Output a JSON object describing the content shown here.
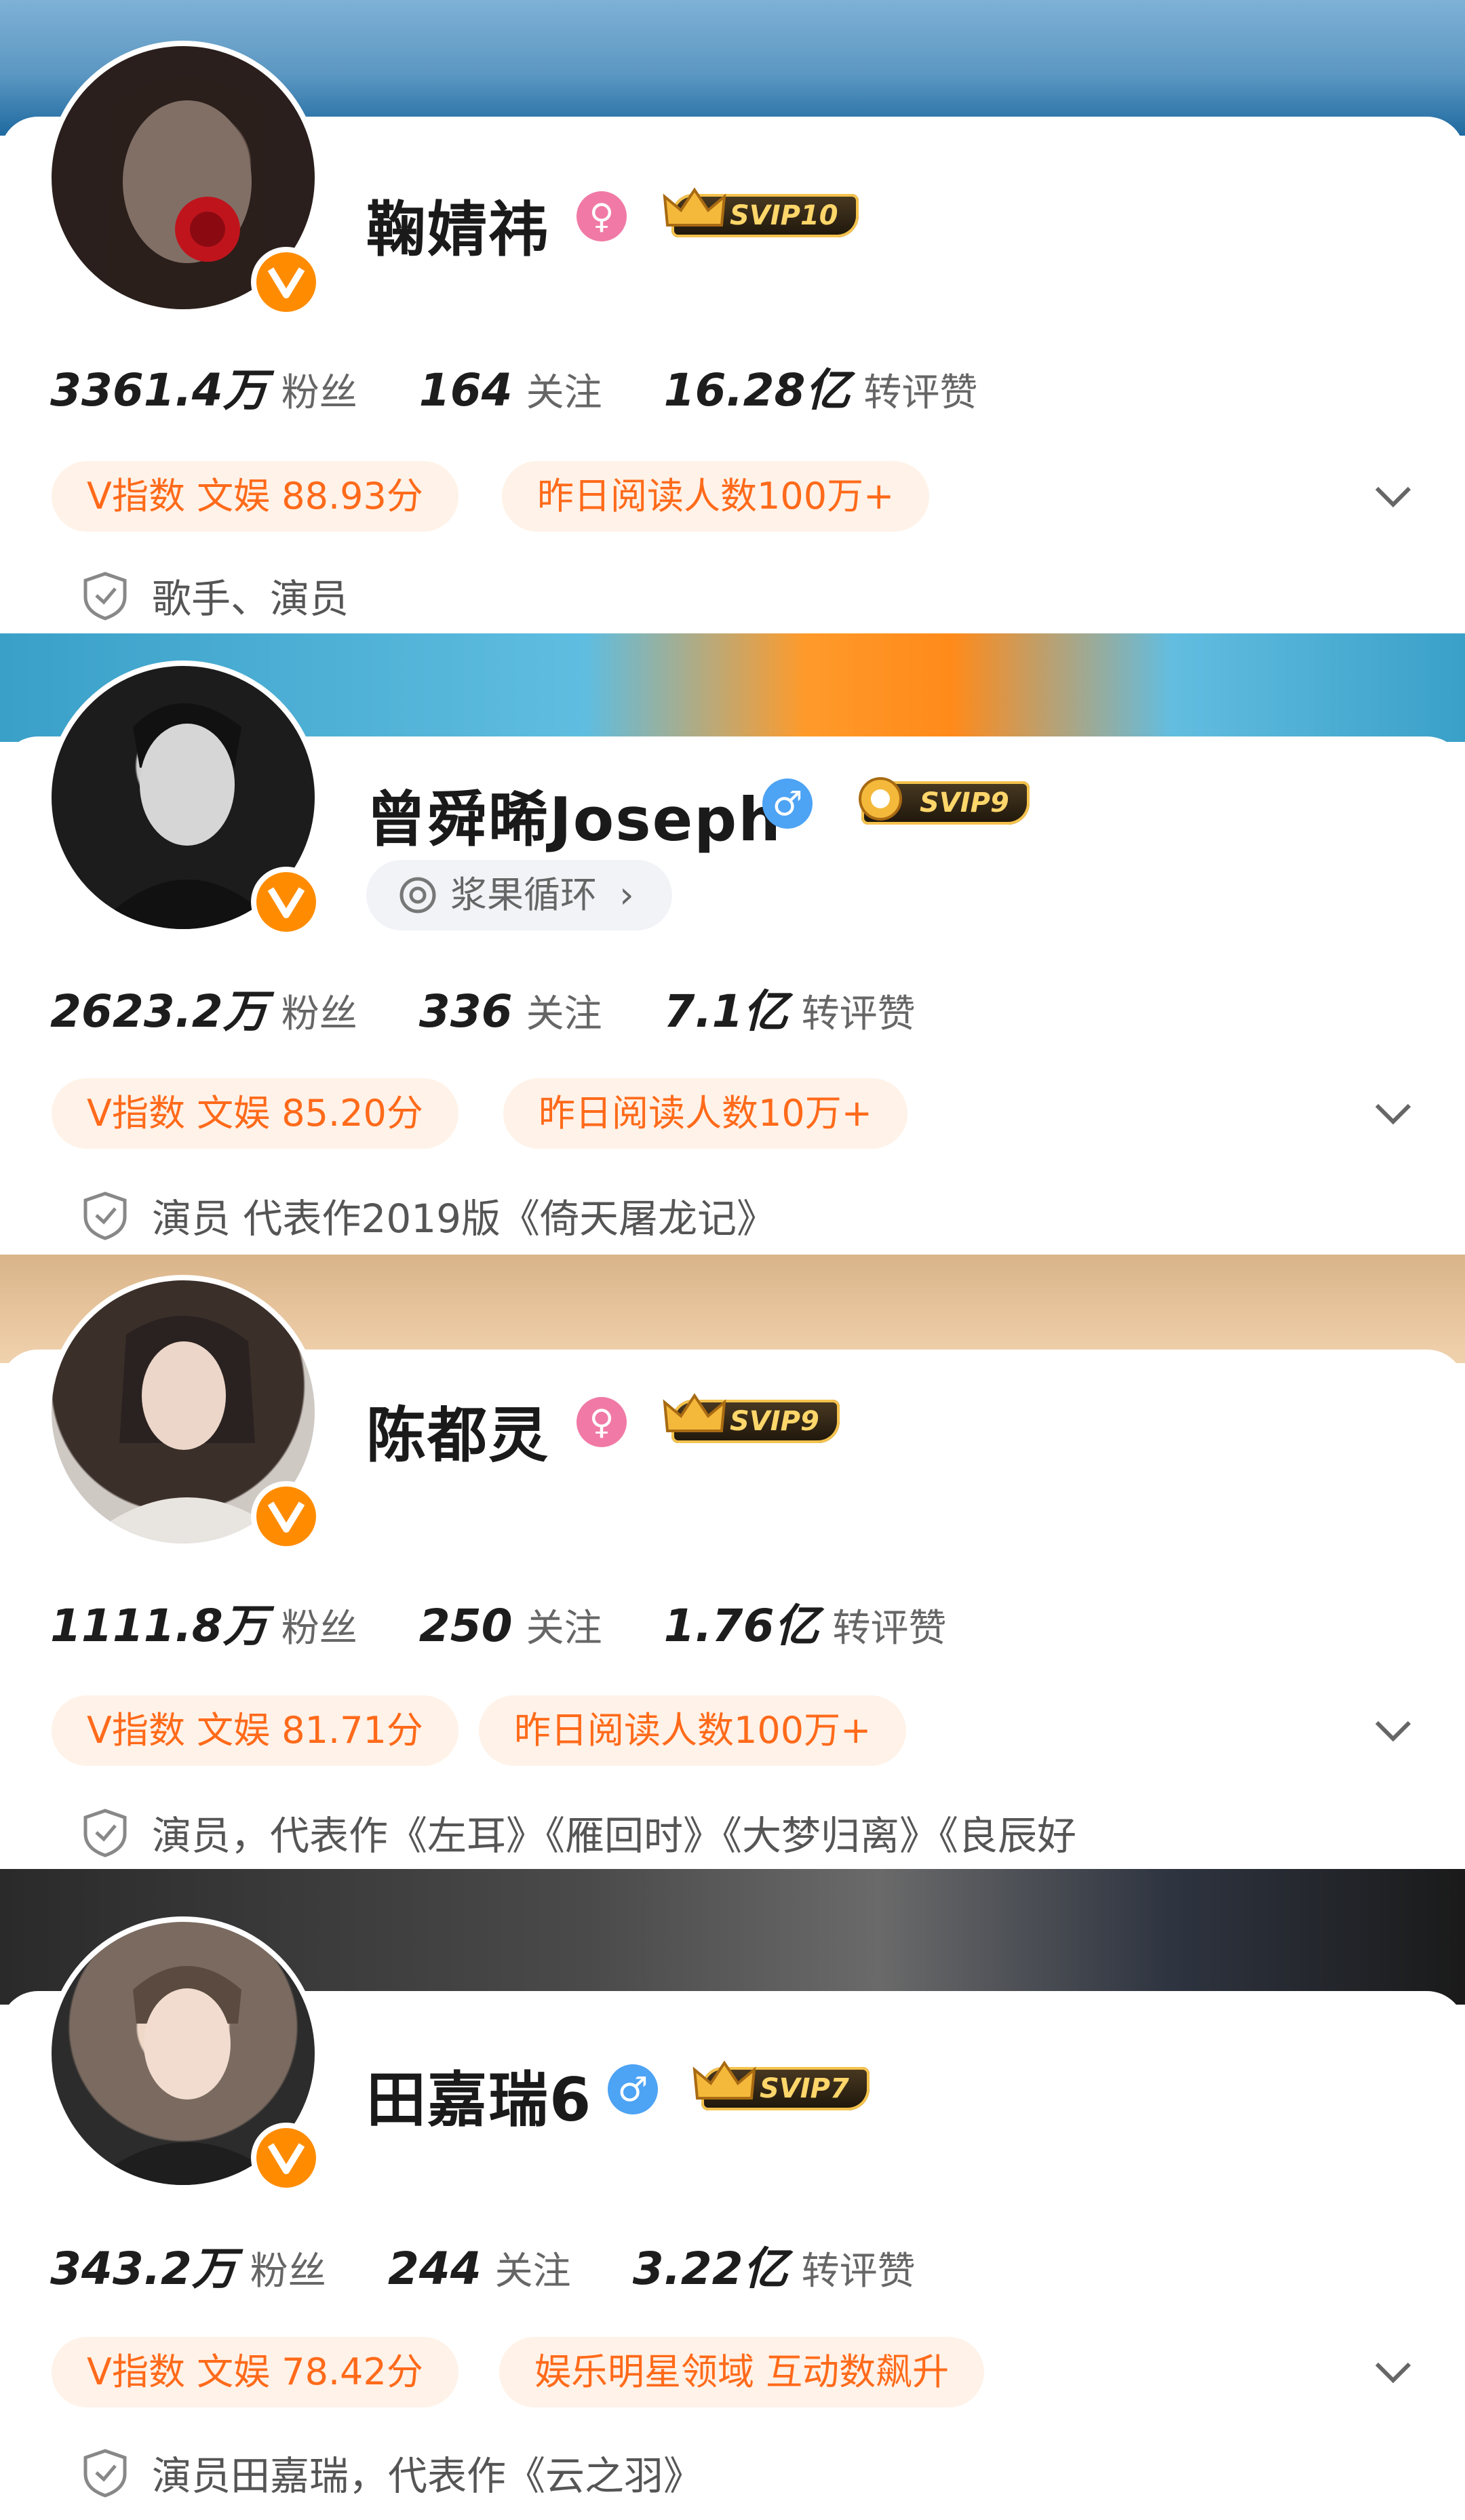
{
  "profiles": [
    {
      "name": "鞠婧祎",
      "gender": "female",
      "gender_symbol": "♀",
      "svip": "SVIP10",
      "fans_num": "3361.4万",
      "fans_label": "粉丝",
      "follow_num": "164",
      "follow_label": "关注",
      "likes_num": "16.28亿",
      "likes_label": "转评赞",
      "index_pill": "V指数 文娱 88.93分",
      "read_pill": "昨日阅读人数100万+",
      "description": "歌手、演员"
    },
    {
      "name": "曾舜晞Joseph",
      "gender": "male",
      "gender_symbol": "♂",
      "svip": "SVIP9",
      "chip": "浆果循环",
      "fans_num": "2623.2万",
      "fans_label": "粉丝",
      "follow_num": "336",
      "follow_label": "关注",
      "likes_num": "7.1亿",
      "likes_label": "转评赞",
      "index_pill": "V指数 文娱 85.20分",
      "read_pill": "昨日阅读人数10万+",
      "description": "演员 代表作2019版《倚天屠龙记》"
    },
    {
      "name": "陈都灵",
      "gender": "female",
      "gender_symbol": "♀",
      "svip": "SVIP9",
      "fans_num": "1111.8万",
      "fans_label": "粉丝",
      "follow_num": "250",
      "follow_label": "关注",
      "likes_num": "1.76亿",
      "likes_label": "转评赞",
      "index_pill": "V指数 文娱 81.71分",
      "read_pill": "昨日阅读人数100万+",
      "description": "演员，代表作《左耳》《雁回时》《大梦归离》《良辰好"
    },
    {
      "name": "田嘉瑞6",
      "gender": "male",
      "gender_symbol": "♂",
      "svip": "SVIP7",
      "fans_num": "343.2万",
      "fans_label": "粉丝",
      "follow_num": "244",
      "follow_label": "关注",
      "likes_num": "3.22亿",
      "likes_label": "转评赞",
      "index_pill": "V指数 文娱 78.42分",
      "read_pill": "娱乐明星领域 互动数飙升",
      "description": "演员田嘉瑞，代表作《云之羽》"
    }
  ],
  "colors": {
    "accent_orange": "#ff6a1a",
    "pill_bg": "#fff2e8",
    "female_badge": "#f07aa5",
    "male_badge": "#4da3f4",
    "verified_badge": "#ff8c00"
  },
  "icons": [
    "verified-v-icon",
    "female-icon",
    "male-icon",
    "crown-icon",
    "chevron-down-icon",
    "shield-icon",
    "music-disc-icon"
  ]
}
